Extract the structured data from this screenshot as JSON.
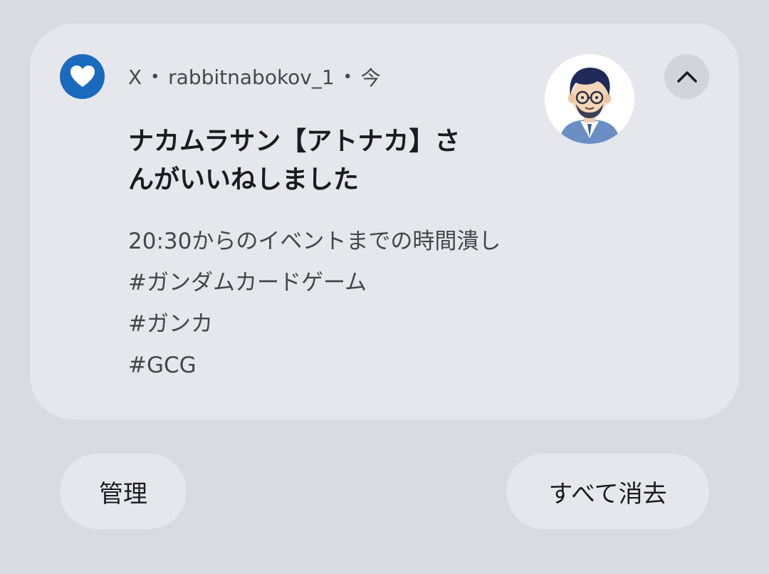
{
  "notification": {
    "app_name": "X",
    "separator": "•",
    "account": "rabbitnabokov_1",
    "time": "今",
    "app_icon": "heart-icon",
    "avatar_icon": "user-avatar",
    "collapse_icon": "chevron-up-icon",
    "title_lines": [
      "ナカムラサン【アトナカ】さ",
      "んがいいねしました"
    ],
    "body_lines": [
      "20:30からのイベントまでの時間潰し",
      "#ガンダムカードゲーム",
      "#ガンカ",
      "#GCG"
    ]
  },
  "actions": {
    "manage_label": "管理",
    "clear_all_label": "すべて消去"
  },
  "colors": {
    "background": "#dadbe0",
    "card": "#e6e7ed",
    "app_icon_bg": "#1a6bbd",
    "collapse_bg": "#d3d4d9",
    "title_text": "#1b1c20",
    "secondary_text": "#45464b"
  }
}
